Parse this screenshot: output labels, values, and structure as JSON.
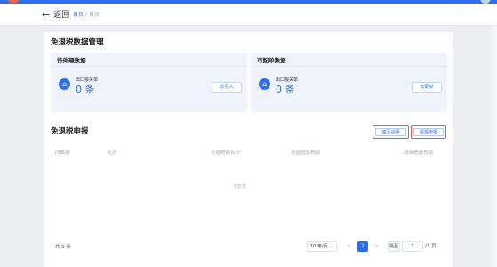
{
  "colors": {
    "accent": "#2e6fe6",
    "highlight": "#e8564a",
    "page_bg": "#eceef2"
  },
  "nav": {
    "back_label": "返回",
    "breadcrumb": [
      "首页",
      "/",
      "首页"
    ]
  },
  "main": {
    "title": "免退税数据管理",
    "panels": [
      {
        "title": "待处理数据",
        "icon": "bank-icon",
        "label": "出口报关单",
        "count": "0 条",
        "button": "去导入"
      },
      {
        "title": "可配单数据",
        "icon": "bank-icon",
        "label": "出口报关单",
        "count": "0 条",
        "button": "去配单"
      }
    ]
  },
  "declaration": {
    "title": "免退税申报",
    "buttons": [
      "填写说明",
      "提报申报"
    ],
    "columns": [
      "所属期",
      "批次",
      "可退税额合计",
      "增值税退税额",
      "消费税退税额"
    ],
    "empty_text": "无数据"
  },
  "pagination": {
    "total": "共 0 条",
    "page_size": "10 条/页",
    "prev": "<",
    "current": "1",
    "next": ">",
    "goto_label": "跳至",
    "goto_value": "1",
    "goto_total": "/1 页"
  }
}
